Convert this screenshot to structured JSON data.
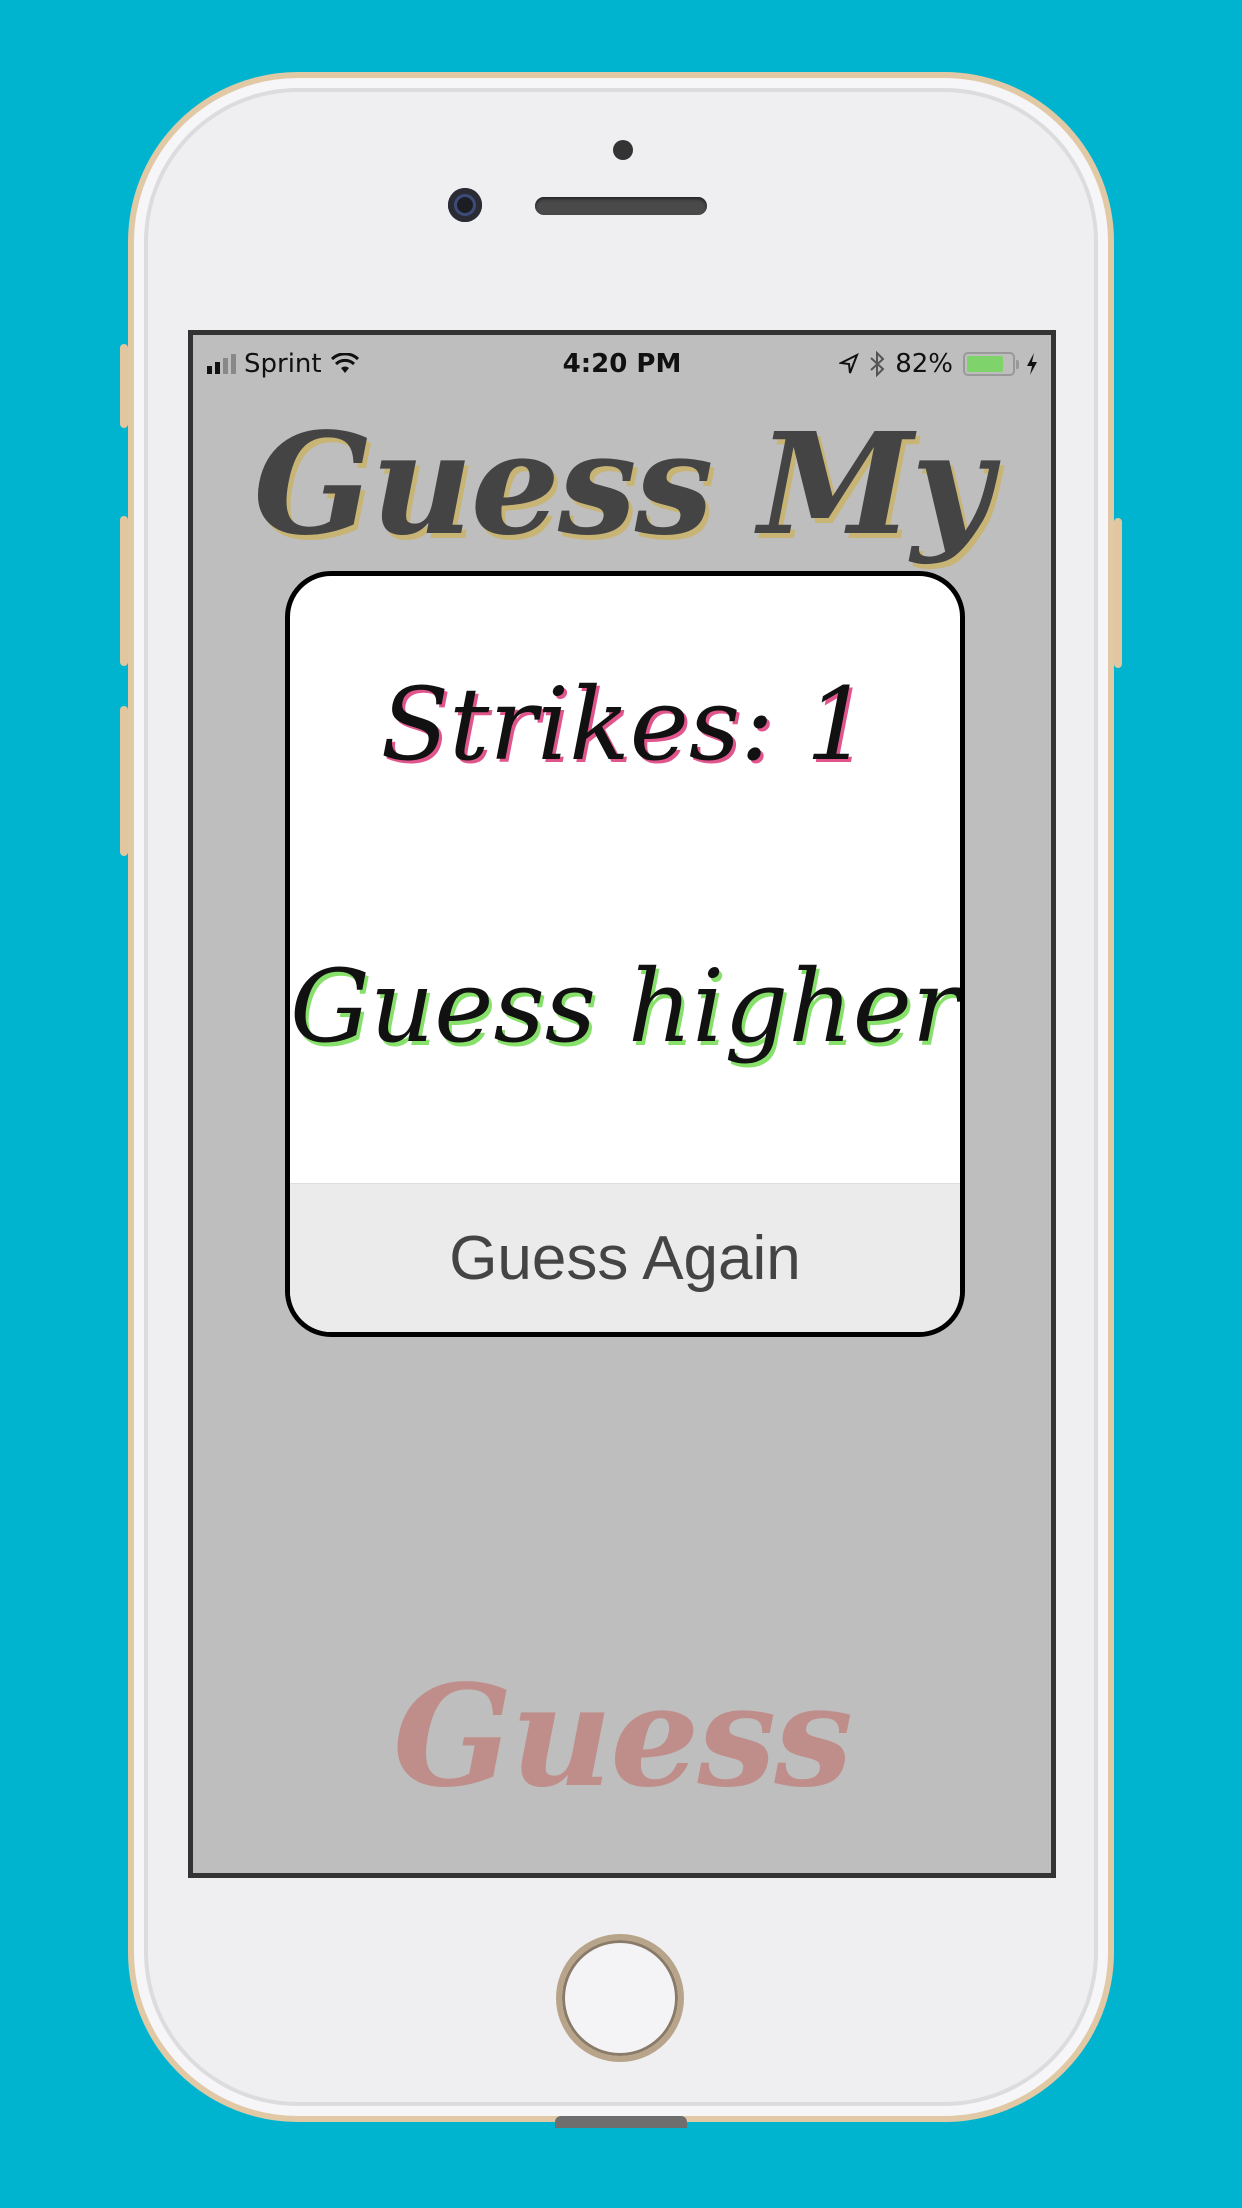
{
  "status_bar": {
    "carrier": "Sprint",
    "time": "4:20 PM",
    "battery_percent": "82%",
    "battery_level": 0.82,
    "icons": [
      "signal-icon",
      "wifi-icon",
      "location-icon",
      "bluetooth-icon",
      "battery-icon",
      "charging-icon"
    ]
  },
  "game": {
    "title": "Guess My",
    "bottom_button": "Guess"
  },
  "alert": {
    "strikes_text": "Strikes: 1",
    "hint_text": "Guess higher!",
    "action_label": "Guess Again"
  },
  "colors": {
    "background": "#00b4cf",
    "screen": "#bebebe",
    "title": "#444444",
    "title_shadow": "#c8b576",
    "bottom_button": "#bf8e8a",
    "strikes_shadow": "#e0558c",
    "hint_shadow": "#86e06a"
  }
}
